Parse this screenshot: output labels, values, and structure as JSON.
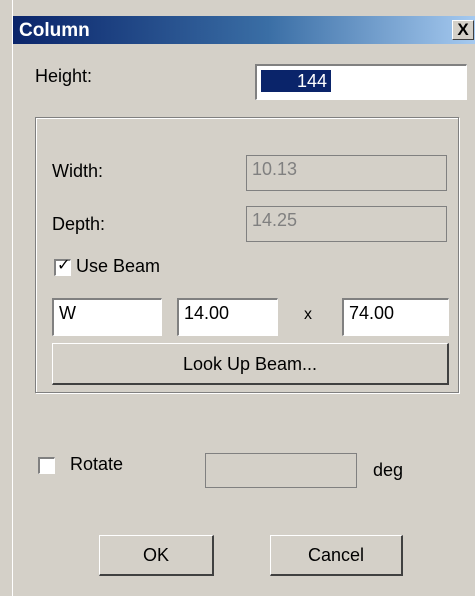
{
  "window": {
    "title": "Column",
    "close_glyph": "X"
  },
  "height": {
    "label": "Height:",
    "value": "144"
  },
  "width": {
    "label": "Width:",
    "value": "10.13"
  },
  "depth": {
    "label": "Depth:",
    "value": "14.25"
  },
  "use_beam": {
    "label": "Use Beam",
    "checked": true,
    "check_glyph": "✓"
  },
  "beam": {
    "prefix": "W",
    "dim1": "14.00",
    "times": "x",
    "dim2": "74.00"
  },
  "lookup_button": "Look Up Beam...",
  "rotate": {
    "label": "Rotate",
    "checked": false,
    "value": "",
    "unit": "deg"
  },
  "buttons": {
    "ok": "OK",
    "cancel": "Cancel"
  }
}
